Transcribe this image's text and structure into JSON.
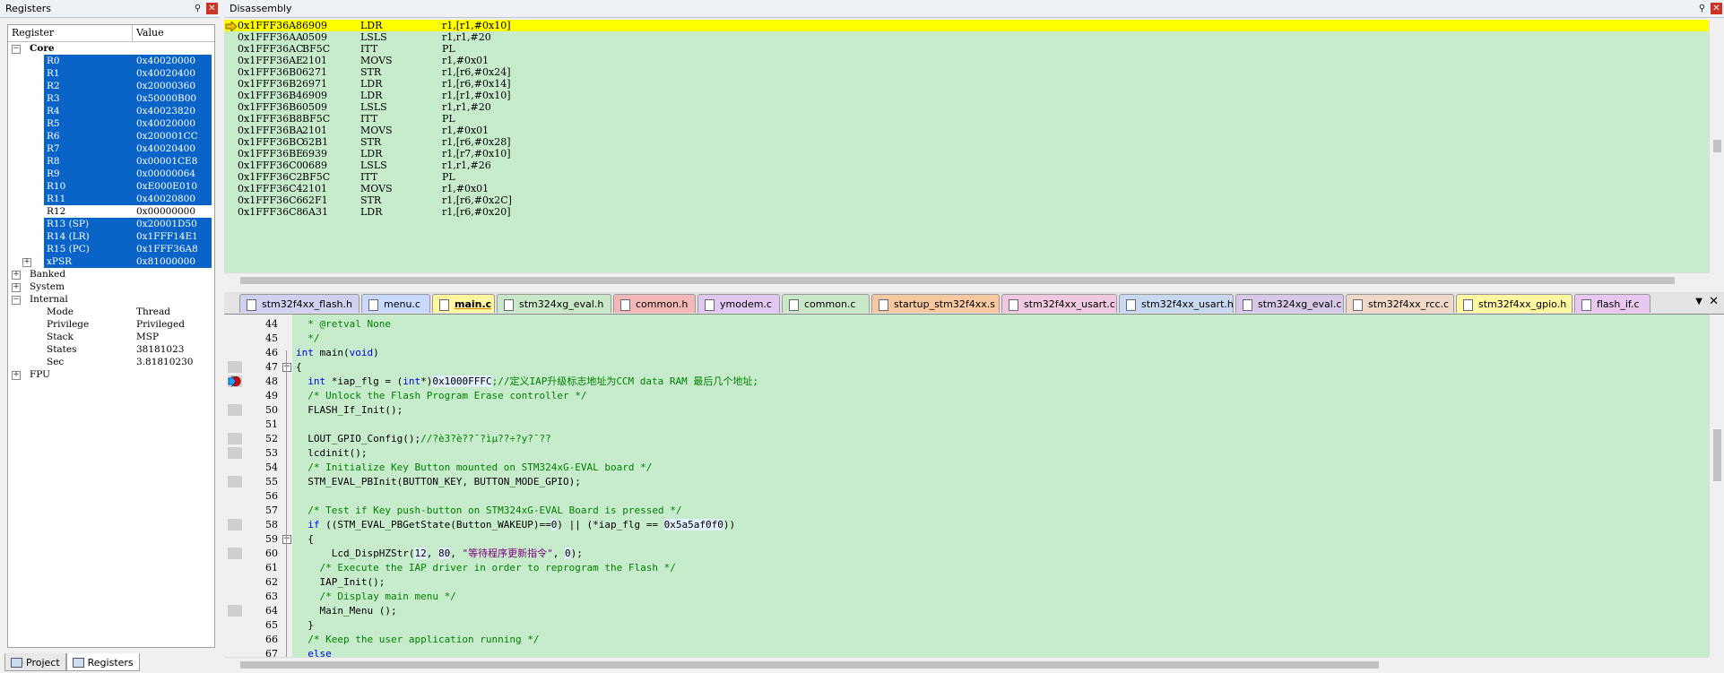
{
  "registers": {
    "title": "Registers",
    "col_register": "Register",
    "col_value": "Value",
    "core_label": "Core",
    "core": [
      {
        "name": "R0",
        "value": "0x40020000"
      },
      {
        "name": "R1",
        "value": "0x40020400"
      },
      {
        "name": "R2",
        "value": "0x20000360"
      },
      {
        "name": "R3",
        "value": "0x50000B00"
      },
      {
        "name": "R4",
        "value": "0x40023820"
      },
      {
        "name": "R5",
        "value": "0x40020000"
      },
      {
        "name": "R6",
        "value": "0x200001CC"
      },
      {
        "name": "R7",
        "value": "0x40020400"
      },
      {
        "name": "R8",
        "value": "0x00001CE8"
      },
      {
        "name": "R9",
        "value": "0x00000064"
      },
      {
        "name": "R10",
        "value": "0xE000E010"
      },
      {
        "name": "R11",
        "value": "0x40020800"
      },
      {
        "name": "R12",
        "value": "0x00000000"
      },
      {
        "name": "R13 (SP)",
        "value": "0x20001D50"
      },
      {
        "name": "R14 (LR)",
        "value": "0x1FFF14E1"
      },
      {
        "name": "R15 (PC)",
        "value": "0x1FFF36A8"
      },
      {
        "name": "xPSR",
        "value": "0x81000000"
      }
    ],
    "banked_label": "Banked",
    "system_label": "System",
    "internal_label": "Internal",
    "internal": [
      {
        "name": "Mode",
        "value": "Thread"
      },
      {
        "name": "Privilege",
        "value": "Privileged"
      },
      {
        "name": "Stack",
        "value": "MSP"
      },
      {
        "name": "States",
        "value": "38181023"
      },
      {
        "name": "Sec",
        "value": "3.81810230"
      }
    ],
    "fpu_label": "FPU",
    "tab_project": "Project",
    "tab_registers": "Registers"
  },
  "disassembly": {
    "title": "Disassembly",
    "lines": [
      {
        "addr": "0x1FFF36A8",
        "code": "6909",
        "op": "LDR",
        "args": "r1,[r1,#0x10]"
      },
      {
        "addr": "0x1FFF36AA",
        "code": "0509",
        "op": "LSLS",
        "args": "r1,r1,#20"
      },
      {
        "addr": "0x1FFF36AC",
        "code": "BF5C",
        "op": "ITT",
        "args": "PL"
      },
      {
        "addr": "0x1FFF36AE",
        "code": "2101",
        "op": "MOVS",
        "args": "r1,#0x01"
      },
      {
        "addr": "0x1FFF36B0",
        "code": "6271",
        "op": "STR",
        "args": "r1,[r6,#0x24]"
      },
      {
        "addr": "0x1FFF36B2",
        "code": "6971",
        "op": "LDR",
        "args": "r1,[r6,#0x14]"
      },
      {
        "addr": "0x1FFF36B4",
        "code": "6909",
        "op": "LDR",
        "args": "r1,[r1,#0x10]"
      },
      {
        "addr": "0x1FFF36B6",
        "code": "0509",
        "op": "LSLS",
        "args": "r1,r1,#20"
      },
      {
        "addr": "0x1FFF36B8",
        "code": "BF5C",
        "op": "ITT",
        "args": "PL"
      },
      {
        "addr": "0x1FFF36BA",
        "code": "2101",
        "op": "MOVS",
        "args": "r1,#0x01"
      },
      {
        "addr": "0x1FFF36BC",
        "code": "62B1",
        "op": "STR",
        "args": "r1,[r6,#0x28]"
      },
      {
        "addr": "0x1FFF36BE",
        "code": "6939",
        "op": "LDR",
        "args": "r1,[r7,#0x10]"
      },
      {
        "addr": "0x1FFF36C0",
        "code": "0689",
        "op": "LSLS",
        "args": "r1,r1,#26"
      },
      {
        "addr": "0x1FFF36C2",
        "code": "BF5C",
        "op": "ITT",
        "args": "PL"
      },
      {
        "addr": "0x1FFF36C4",
        "code": "2101",
        "op": "MOVS",
        "args": "r1,#0x01"
      },
      {
        "addr": "0x1FFF36C6",
        "code": "62F1",
        "op": "STR",
        "args": "r1,[r6,#0x2C]"
      },
      {
        "addr": "0x1FFF36C8",
        "code": "6A31",
        "op": "LDR",
        "args": "r1,[r6,#0x20]"
      }
    ]
  },
  "tabs": [
    {
      "label": "stm32f4xx_flash.h",
      "color": "#d0d0f0"
    },
    {
      "label": "menu.c",
      "color": "#c8d8ff"
    },
    {
      "label": "main.c",
      "color": "#fff7a0"
    },
    {
      "label": "stm324xg_eval.h",
      "color": "#c8e8c8"
    },
    {
      "label": "common.h",
      "color": "#f4b8b8"
    },
    {
      "label": "ymodem.c",
      "color": "#e0c8f0"
    },
    {
      "label": "common.c",
      "color": "#c8e8c8"
    },
    {
      "label": "startup_stm32f4xx.s",
      "color": "#f8c8a0"
    },
    {
      "label": "stm32f4xx_usart.c",
      "color": "#f0c8e0"
    },
    {
      "label": "stm32f4xx_usart.h",
      "color": "#c8d8f0"
    },
    {
      "label": "stm324xg_eval.c",
      "color": "#d8c8e8"
    },
    {
      "label": "stm32f4xx_rcc.c",
      "color": "#f0d8c8"
    },
    {
      "label": "stm32f4xx_gpio.h",
      "color": "#fff7a0"
    },
    {
      "label": "flash_if.c",
      "color": "#e8c8f0"
    }
  ],
  "editor": {
    "lines": [
      {
        "n": "44",
        "parts": [
          {
            "t": "  * @retval None",
            "c": "cm"
          }
        ]
      },
      {
        "n": "45",
        "parts": [
          {
            "t": "  */",
            "c": "cm"
          }
        ]
      },
      {
        "n": "46",
        "parts": [
          {
            "t": "int",
            "c": "kw"
          },
          {
            "t": " main(",
            "c": "tx"
          },
          {
            "t": "void",
            "c": "kw"
          },
          {
            "t": ")",
            "c": "tx"
          }
        ]
      },
      {
        "n": "47",
        "parts": [
          {
            "t": "{",
            "c": "tx"
          }
        ]
      },
      {
        "n": "48",
        "parts": [
          {
            "t": "  ",
            "c": "tx"
          },
          {
            "t": "int",
            "c": "kw"
          },
          {
            "t": " *iap_flg = (",
            "c": "tx"
          },
          {
            "t": "int",
            "c": "kw"
          },
          {
            "t": "*)",
            "c": "tx"
          },
          {
            "t": "0x1000FFFC",
            "c": "nb"
          },
          {
            "t": ";//定义IAP升级标志地址为CCM data RAM 最后几个地址;",
            "c": "cm"
          }
        ]
      },
      {
        "n": "49",
        "parts": [
          {
            "t": "  /* Unlock the Flash Program Erase controller */",
            "c": "cm"
          }
        ]
      },
      {
        "n": "50",
        "parts": [
          {
            "t": "  FLASH_If_Init();",
            "c": "tx"
          }
        ]
      },
      {
        "n": "51",
        "parts": [
          {
            "t": "",
            "c": "tx"
          }
        ]
      },
      {
        "n": "52",
        "parts": [
          {
            "t": "  LOUT_GPIO_Config();",
            "c": "tx"
          },
          {
            "t": "//?è3?è??¯?ìµ??÷?y?¯??",
            "c": "cm"
          }
        ]
      },
      {
        "n": "53",
        "parts": [
          {
            "t": "  lcdinit();",
            "c": "tx"
          }
        ]
      },
      {
        "n": "54",
        "parts": [
          {
            "t": "  /* Initialize Key Button mounted on STM324xG-EVAL board */",
            "c": "cm"
          }
        ]
      },
      {
        "n": "55",
        "parts": [
          {
            "t": "  STM_EVAL_PBInit(BUTTON_KEY, BUTTON_MODE_GPIO);",
            "c": "tx"
          }
        ]
      },
      {
        "n": "56",
        "parts": [
          {
            "t": "",
            "c": "tx"
          }
        ]
      },
      {
        "n": "57",
        "parts": [
          {
            "t": "  /* Test if Key push-button on STM324xG-EVAL Board is pressed */",
            "c": "cm"
          }
        ]
      },
      {
        "n": "58",
        "parts": [
          {
            "t": "  ",
            "c": "tx"
          },
          {
            "t": "if",
            "c": "kw"
          },
          {
            "t": " ((STM_EVAL_PBGetState(Button_WAKEUP)==",
            "c": "tx"
          },
          {
            "t": "0",
            "c": "nb"
          },
          {
            "t": ") || (*iap_flg == ",
            "c": "tx"
          },
          {
            "t": "0x5a5af0f0",
            "c": "nb"
          },
          {
            "t": "))",
            "c": "tx"
          }
        ]
      },
      {
        "n": "59",
        "parts": [
          {
            "t": "  {",
            "c": "tx"
          }
        ]
      },
      {
        "n": "60",
        "parts": [
          {
            "t": "      Lcd_DispHZStr(",
            "c": "tx"
          },
          {
            "t": "12",
            "c": "nb"
          },
          {
            "t": ", ",
            "c": "tx"
          },
          {
            "t": "80",
            "c": "nb"
          },
          {
            "t": ", ",
            "c": "tx"
          },
          {
            "t": "\"等待程序更新指令\"",
            "c": "st"
          },
          {
            "t": ", ",
            "c": "tx"
          },
          {
            "t": "0",
            "c": "nb"
          },
          {
            "t": ");",
            "c": "tx"
          }
        ]
      },
      {
        "n": "61",
        "parts": [
          {
            "t": "    /* Execute the IAP driver in order to reprogram the Flash */",
            "c": "cm"
          }
        ]
      },
      {
        "n": "62",
        "parts": [
          {
            "t": "    IAP_Init();",
            "c": "tx"
          }
        ]
      },
      {
        "n": "63",
        "parts": [
          {
            "t": "    /* Display main menu */",
            "c": "cm"
          }
        ]
      },
      {
        "n": "64",
        "parts": [
          {
            "t": "    Main_Menu ();",
            "c": "tx"
          }
        ]
      },
      {
        "n": "65",
        "parts": [
          {
            "t": "  }",
            "c": "tx"
          }
        ]
      },
      {
        "n": "66",
        "parts": [
          {
            "t": "  /* Keep the user application running */",
            "c": "cm"
          }
        ]
      },
      {
        "n": "67",
        "parts": [
          {
            "t": "  ",
            "c": "tx"
          },
          {
            "t": "else",
            "c": "kw"
          }
        ]
      }
    ]
  },
  "colors": {
    "code_bg": "#c6eccb",
    "selection": "#0a64c8",
    "current_line": "#ffff00",
    "keyword": "#0000ee",
    "comment": "#008000",
    "string": "#800080"
  }
}
